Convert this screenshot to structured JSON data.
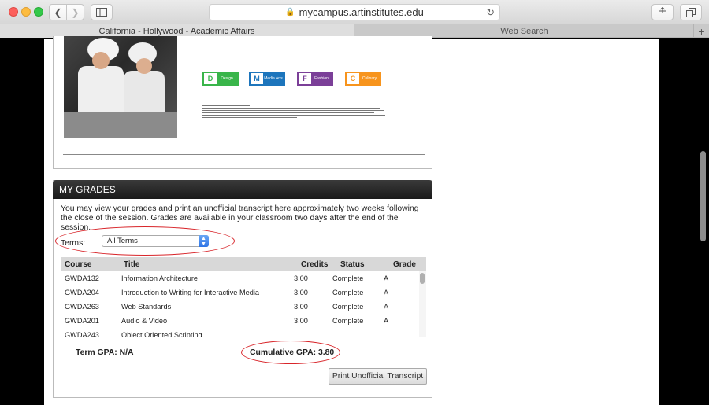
{
  "browser": {
    "url": "mycampus.artinstitutes.edu",
    "tabs": [
      {
        "label": "California - Hollywood - Academic Affairs",
        "active": true
      },
      {
        "label": "Web Search",
        "active": false
      }
    ],
    "icons": {
      "back": "back-chevron-icon",
      "forward": "forward-chevron-icon",
      "sidebar": "sidebar-icon",
      "lock": "lock-icon",
      "reload": "reload-icon",
      "share": "share-icon",
      "tabs": "tabs-overview-icon",
      "add_tab": "plus-icon"
    }
  },
  "ad": {
    "badges": [
      {
        "letter": "D",
        "name": "Design",
        "color": "#39b54a"
      },
      {
        "letter": "M",
        "name": "Media Arts",
        "color": "#1d75bc"
      },
      {
        "letter": "F",
        "name": "Fashion",
        "color": "#7b3f98"
      },
      {
        "letter": "C",
        "name": "Culinary",
        "color": "#f7941d"
      }
    ]
  },
  "grades": {
    "header": "MY GRADES",
    "intro": "You may view your grades and print an unofficial transcript here approximately two weeks following the close of the session. Grades are available in your classroom two days after the end of the session.",
    "terms_label": "Terms:",
    "terms_value": "All Terms",
    "columns": {
      "course": "Course",
      "title": "Title",
      "credits": "Credits",
      "status": "Status",
      "grade": "Grade"
    },
    "rows": [
      {
        "course": "GWDA132",
        "title": "Information Architecture",
        "credits": "3.00",
        "status": "Complete",
        "grade": "A"
      },
      {
        "course": "GWDA204",
        "title": "Introduction to Writing for Interactive Media",
        "credits": "3.00",
        "status": "Complete",
        "grade": "A"
      },
      {
        "course": "GWDA263",
        "title": "Web Standards",
        "credits": "3.00",
        "status": "Complete",
        "grade": "A"
      },
      {
        "course": "GWDA201",
        "title": "Audio & Video",
        "credits": "3.00",
        "status": "Complete",
        "grade": "A"
      },
      {
        "course": "GWDA243",
        "title": "Object Oriented Scripting",
        "credits": "",
        "status": "",
        "grade": ""
      }
    ],
    "term_gpa": "Term GPA: N/A",
    "cumulative_gpa": "Cumulative GPA: 3.80",
    "print_button": "Print Unofficial Transcript",
    "highlight_color": "#d8252a"
  }
}
